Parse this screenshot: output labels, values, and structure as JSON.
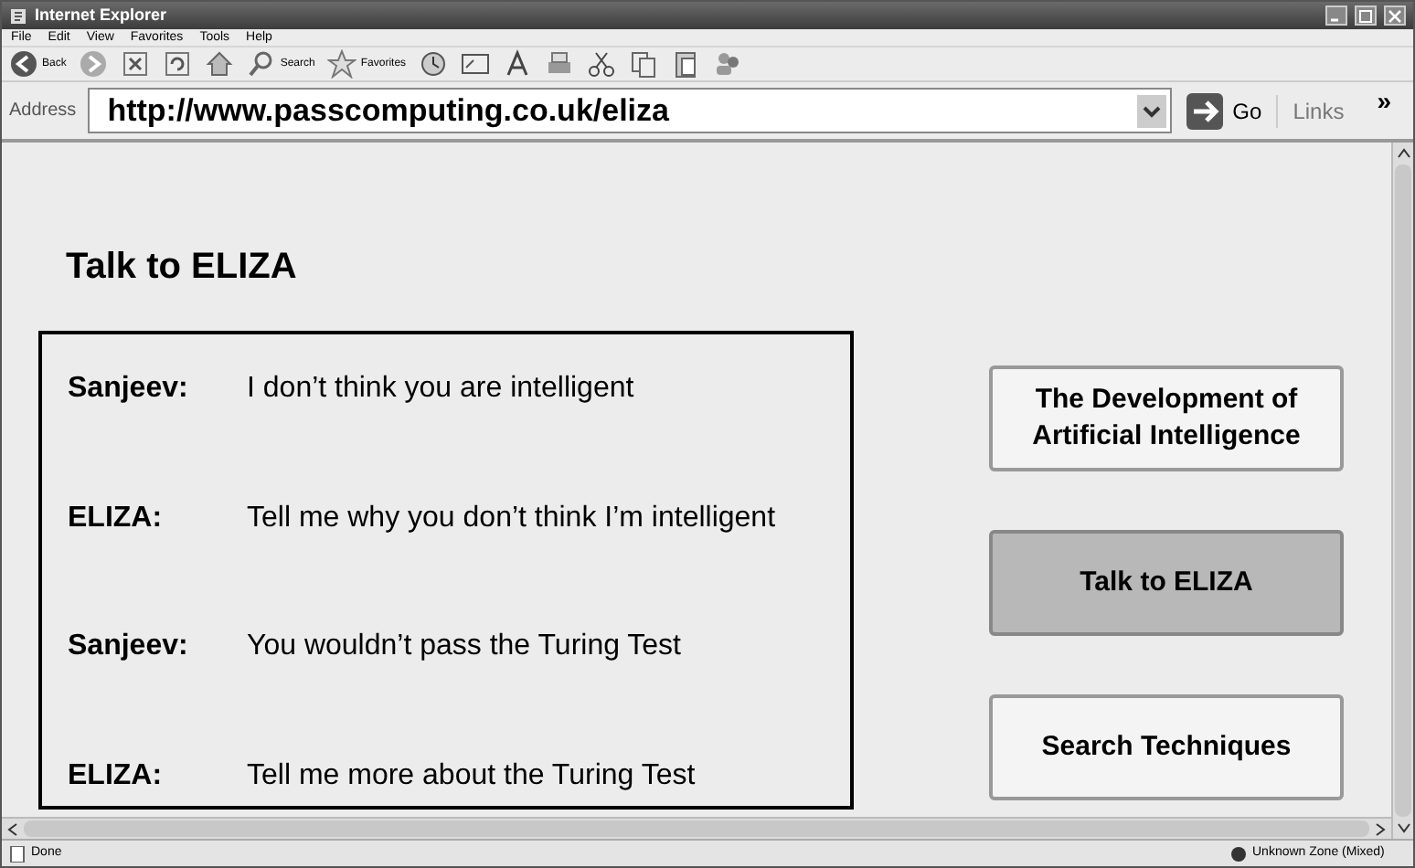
{
  "window": {
    "title": "Internet Explorer"
  },
  "menu": [
    "File",
    "Edit",
    "View",
    "Favorites",
    "Tools",
    "Help"
  ],
  "toolbar": [
    {
      "kind": "back",
      "label": "Back"
    },
    {
      "kind": "forward"
    },
    {
      "kind": "stop"
    },
    {
      "kind": "refresh"
    },
    {
      "kind": "home"
    },
    {
      "kind": "search",
      "label": "Search"
    },
    {
      "kind": "favorites",
      "label": "Favorites"
    },
    {
      "kind": "history"
    },
    {
      "kind": "media"
    },
    {
      "kind": "font"
    },
    {
      "kind": "print"
    },
    {
      "kind": "cut"
    },
    {
      "kind": "copy"
    },
    {
      "kind": "paste"
    },
    {
      "kind": "people"
    }
  ],
  "address": {
    "label": "Address",
    "value": "http://www.passcomputing.co.uk/eliza",
    "go": "Go",
    "links": "Links",
    "more": "»"
  },
  "page": {
    "heading": "Talk to ELIZA",
    "chat": [
      {
        "speaker": "Sanjeev:",
        "text": "I don’t think you are intelligent"
      },
      {
        "speaker": "ELIZA:",
        "text": "Tell me why you don’t think I’m intelligent"
      },
      {
        "speaker": "Sanjeev:",
        "text": "You wouldn’t pass the Turing Test"
      },
      {
        "speaker": "ELIZA:",
        "text": "Tell me more about the Turing Test"
      }
    ],
    "nav": [
      {
        "label": "The Development of Artificial Intelligence",
        "selected": false
      },
      {
        "label": "Talk to ELIZA",
        "selected": true
      },
      {
        "label": "Search Techniques",
        "selected": false
      }
    ]
  },
  "status_bar": {
    "text": "Done",
    "zone": "Unknown Zone (Mixed)"
  }
}
